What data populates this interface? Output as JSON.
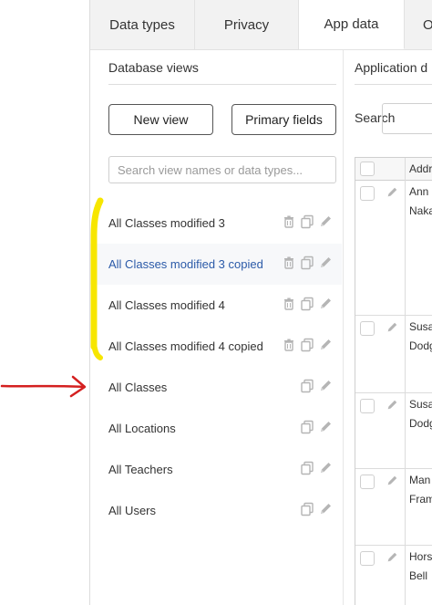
{
  "tabs": [
    {
      "label": "Data types",
      "active": false
    },
    {
      "label": "Privacy",
      "active": false
    },
    {
      "label": "App data",
      "active": true
    },
    {
      "label": "O",
      "active": false
    }
  ],
  "left_panel": {
    "title": "Database views",
    "new_view_label": "New view",
    "primary_fields_label": "Primary fields",
    "search_placeholder": "Search view names or data types...",
    "views": [
      {
        "label": "All Classes modified 3",
        "deletable": true,
        "selected": false
      },
      {
        "label": "All Classes modified 3 copied",
        "deletable": true,
        "selected": true
      },
      {
        "label": "All Classes modified 4",
        "deletable": true,
        "selected": false
      },
      {
        "label": "All Classes modified 4 copied",
        "deletable": true,
        "selected": false
      },
      {
        "label": "All Classes",
        "deletable": false,
        "selected": false
      },
      {
        "label": "All Locations",
        "deletable": false,
        "selected": false
      },
      {
        "label": "All Teachers",
        "deletable": false,
        "selected": false
      },
      {
        "label": "All Users",
        "deletable": false,
        "selected": false
      }
    ]
  },
  "right_panel": {
    "title": "Application d",
    "search_label": "Search",
    "column_header": "Addr",
    "rows": [
      {
        "line1": "Ann",
        "line2": "Naka"
      },
      {
        "line1": "Susa",
        "line2": "Dodg"
      },
      {
        "line1": "Susa",
        "line2": "Dodg"
      },
      {
        "line1": "Man",
        "line2": "Fram"
      },
      {
        "line1": "Hors",
        "line2": "Bell"
      }
    ]
  },
  "colors": {
    "accent_link": "#2b5aa8",
    "highlighter": "#f7e600",
    "arrow": "#d42020",
    "icon_gray": "#b5b5b5"
  }
}
